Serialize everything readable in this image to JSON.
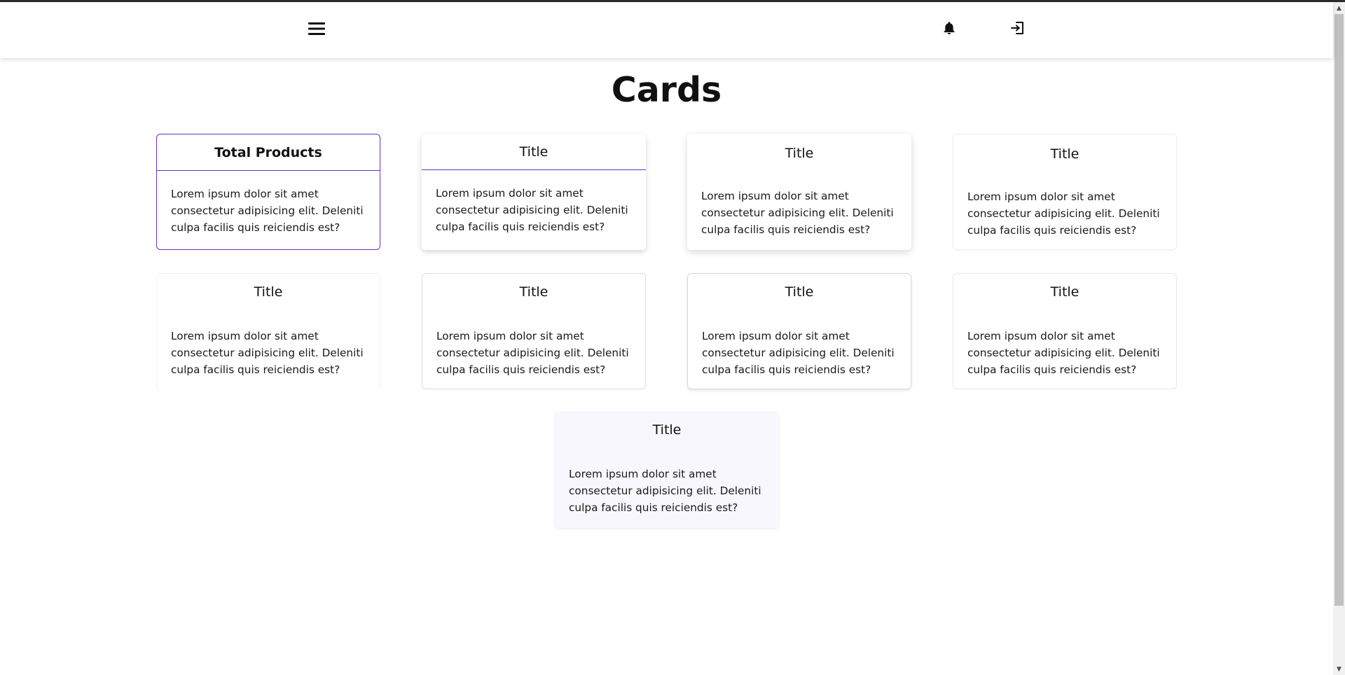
{
  "page": {
    "title": "Cards"
  },
  "navbar": {
    "icons": [
      "hamburger-menu-icon",
      "bell-icon",
      "logout-icon"
    ]
  },
  "colors": {
    "accent": "#6a2fd1",
    "tinted_card_bg": "#f8f7fd"
  },
  "cards": [
    {
      "title": "Total Products",
      "body": "Lorem ipsum dolor sit amet consectetur adipisicing elit. Deleniti culpa facilis quis reiciendis est?"
    },
    {
      "title": "Title",
      "body": "Lorem ipsum dolor sit amet consectetur adipisicing elit. Deleniti culpa facilis quis reiciendis est?"
    },
    {
      "title": "Title",
      "body": "Lorem ipsum dolor sit amet consectetur adipisicing elit. Deleniti culpa facilis quis reiciendis est?"
    },
    {
      "title": "Title",
      "body": "Lorem ipsum dolor sit amet consectetur adipisicing elit. Deleniti culpa facilis quis reiciendis est?"
    },
    {
      "title": "Title",
      "body": "Lorem ipsum dolor sit amet consectetur adipisicing elit. Deleniti culpa facilis quis reiciendis est?"
    },
    {
      "title": "Title",
      "body": "Lorem ipsum dolor sit amet consectetur adipisicing elit. Deleniti culpa facilis quis reiciendis est?"
    },
    {
      "title": "Title",
      "body": "Lorem ipsum dolor sit amet consectetur adipisicing elit. Deleniti culpa facilis quis reiciendis est?"
    },
    {
      "title": "Title",
      "body": "Lorem ipsum dolor sit amet consectetur adipisicing elit. Deleniti culpa facilis quis reiciendis est?"
    },
    {
      "title": "Title",
      "body": "Lorem ipsum dolor sit amet consectetur adipisicing elit. Deleniti culpa facilis quis reiciendis est?"
    }
  ]
}
